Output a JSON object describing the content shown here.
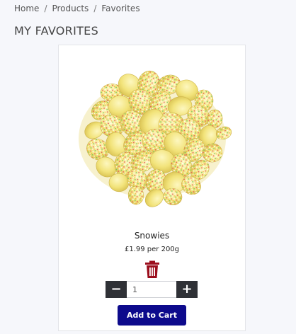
{
  "breadcrumb": {
    "items": [
      "Home",
      "Products",
      "Favorites"
    ],
    "separator": "/"
  },
  "page": {
    "title": "MY FAVORITES"
  },
  "product": {
    "name": "Snowies",
    "price": "£1.99 per 200g",
    "image_icon": "product-photo-icon",
    "delete_icon": "trash-icon",
    "quantity": "1",
    "decrement_label": "−",
    "increment_label": "+",
    "add_to_cart_label": "Add to Cart"
  },
  "colors": {
    "accent": "#0d0a8c",
    "delete": "#9b0d1c",
    "qty_button": "#2f3136"
  }
}
